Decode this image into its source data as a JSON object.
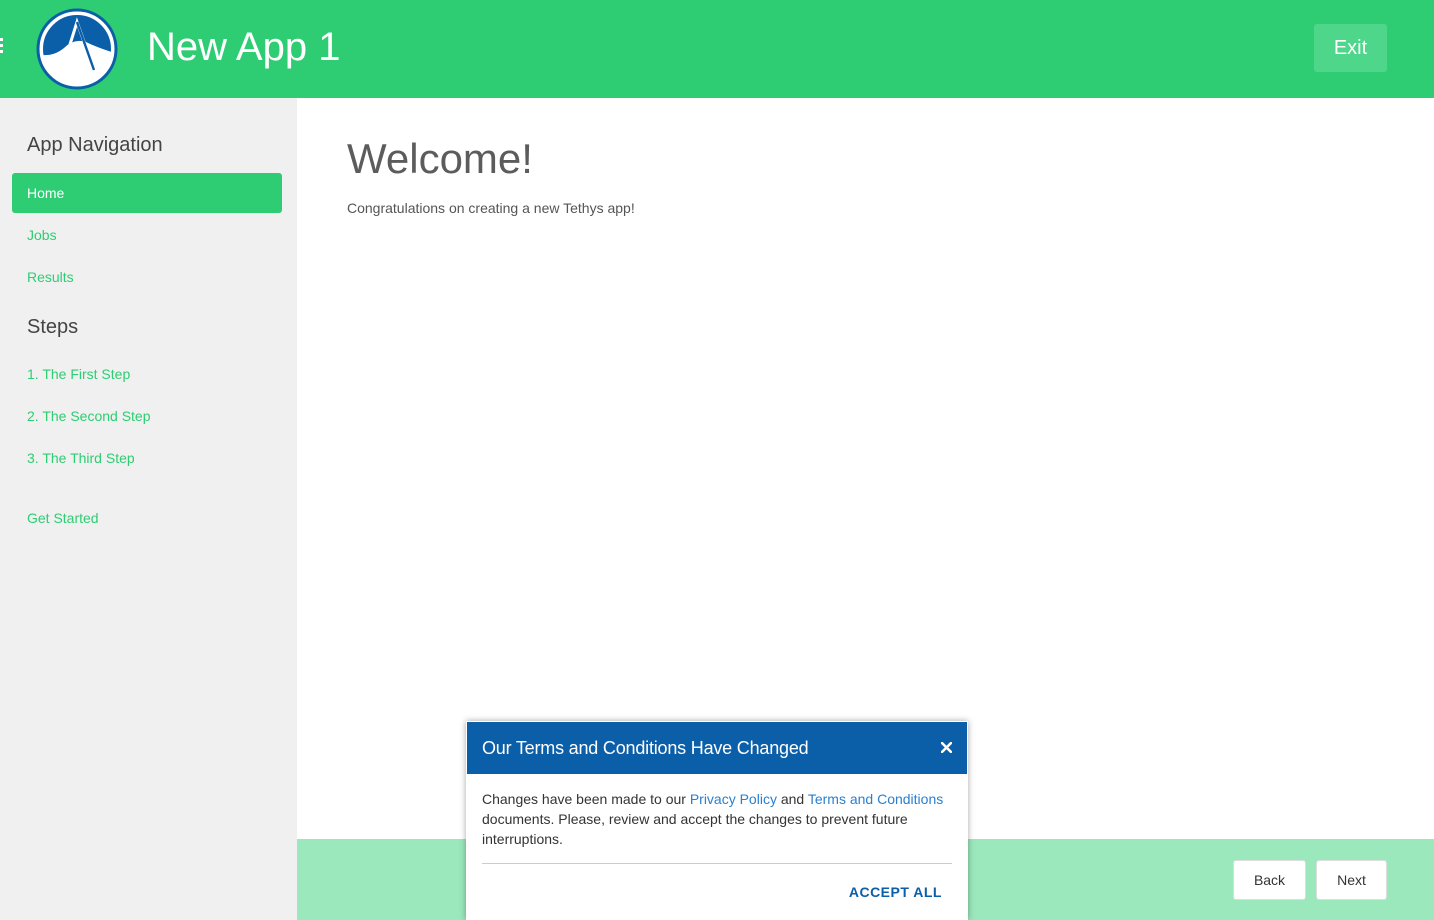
{
  "header": {
    "title": "New App 1",
    "exit_label": "Exit",
    "color": "#2ecd73",
    "menu_icon": "hamburger-menu-icon",
    "logo_icon": "tethys-logo"
  },
  "sidebar": {
    "nav_heading": "App Navigation",
    "nav_items": [
      {
        "label": "Home",
        "active": true
      },
      {
        "label": "Jobs",
        "active": false
      },
      {
        "label": "Results",
        "active": false
      }
    ],
    "steps_heading": "Steps",
    "step_items": [
      {
        "label": "1. The First Step"
      },
      {
        "label": "2. The Second Step"
      },
      {
        "label": "3. The Third Step"
      }
    ],
    "get_started_label": "Get Started"
  },
  "main": {
    "title": "Welcome!",
    "text": "Congratulations on creating a new Tethys app!"
  },
  "footer": {
    "back_label": "Back",
    "next_label": "Next",
    "color": "#9ae8bb"
  },
  "modal": {
    "title": "Our Terms and Conditions Have Changed",
    "close_icon": "close-icon",
    "body_prefix": "Changes have been made to our ",
    "privacy_link": "Privacy Policy",
    "body_and": " and ",
    "terms_link": "Terms and Conditions",
    "body_suffix": " documents. Please, review and accept the changes to prevent future interruptions.",
    "accept_label": "ACCEPT ALL",
    "header_color": "#0b5ea8"
  }
}
